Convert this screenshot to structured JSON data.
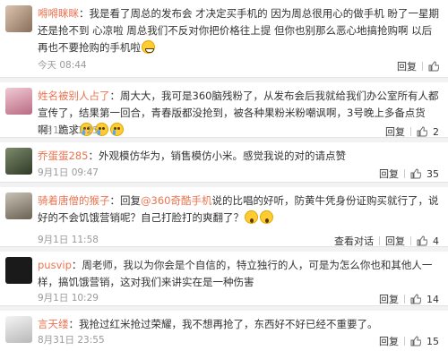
{
  "comments": [
    {
      "username": "嘚嘚眯眯",
      "text": "我是看了周总的发布会 才决定买手机的 因为周总很用心的做手机 盼了一星期 还是抢不到 心凉啦 周总我们不反对你把价格往上提 但你也别那么恶心地搞抢购啊 以后再也不要抢购的手机啦",
      "time": "今天 08:44",
      "reply_label": "回复",
      "likes": ""
    },
    {
      "username": "姓名被别人占了",
      "text": "周大大，我可是360脑残粉了，从发布会后我就给我们办公室所有人都宣传了，结果第一回合，青春版都没抢到，被各种果粉米粉嘲讽啊，3号晚上多备点货啊！跪求",
      "time": "9月1日 21:25",
      "reply_label": "回复",
      "likes": "2"
    },
    {
      "username": "乔蛋蛋285",
      "text": "外观模仿华为，销售模仿小米。感觉我说的对的请点赞",
      "time": "9月1日 09:47",
      "reply_label": "回复",
      "likes": "35"
    },
    {
      "username": "骑着唐僧的猴子",
      "text_pre": "回复",
      "mention": "@360奇酷手机",
      "text": "说的比唱的好听，防黄牛凭身份证购买就行了，说好的不会饥饿营销呢？自己打脸打的爽翻了？",
      "time": "9月1日 11:58",
      "view_label": "查看对话",
      "reply_label": "回复",
      "likes": "4"
    },
    {
      "username": "pusvip",
      "text": "周老师，我以为你会是个自信的，特立独行的人，可是为怎么你也和其他人一样，搞饥饿营销，这对我们来讲实在是一种伤害",
      "time": "9月1日 10:29",
      "reply_label": "回复",
      "likes": "14"
    },
    {
      "username": "言天缕",
      "text": "我抢过红米抢过荣耀，我不想再抢了，东西好不好已经不重要了。",
      "time": "8月31日 23:55",
      "reply_label": "回复",
      "likes": "15"
    }
  ],
  "colors": {
    "username": "#eb7350",
    "meta": "#999999",
    "divider": "#e4e4e4"
  }
}
